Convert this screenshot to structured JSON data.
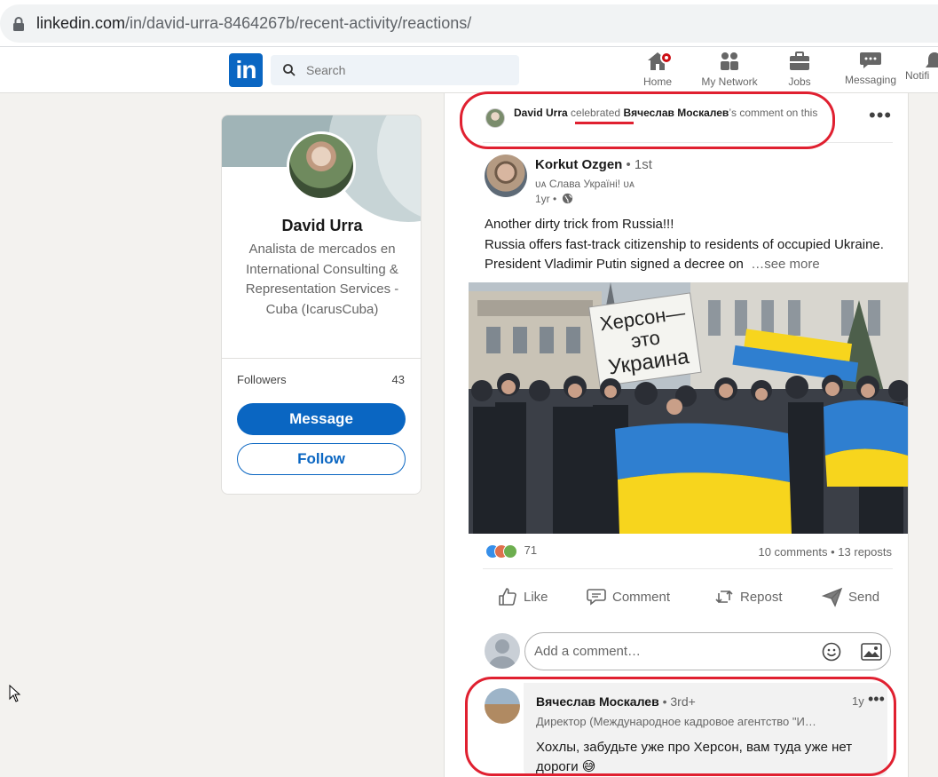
{
  "browser": {
    "url_host": "linkedin.com",
    "url_path": "/in/david-urra-8464267b/recent-activity/reactions/"
  },
  "nav": {
    "logo_text": "in",
    "search_placeholder": "Search",
    "items": [
      {
        "label": "Home",
        "icon": "home-icon"
      },
      {
        "label": "My Network",
        "icon": "network-icon"
      },
      {
        "label": "Jobs",
        "icon": "briefcase-icon"
      },
      {
        "label": "Messaging",
        "icon": "messaging-icon"
      },
      {
        "label": "Notifi",
        "icon": "bell-icon"
      }
    ]
  },
  "profile": {
    "name": "David Urra",
    "headline": "Analista de mercados en International Consulting & Representation Services - Cuba (IcarusCuba)",
    "followers_label": "Followers",
    "followers_count": "43",
    "message_label": "Message",
    "follow_label": "Follow"
  },
  "activity": {
    "actor": "David Urra",
    "verb": "celebrated",
    "target": "Вячеслав Москалев",
    "suffix": "’s comment on this"
  },
  "post": {
    "author_name": "Korkut Ozgen",
    "author_degree": " • 1st",
    "author_tagline": "ᴜᴀ Слава Україні! ᴜᴀ",
    "time": "1yr •",
    "text_line1": "Another dirty trick from Russia!!!",
    "text_line2": "Russia offers fast-track citizenship to residents of occupied Ukraine. President Vladimir Putin signed a decree on",
    "see_more": "…see more",
    "image_sign": "Херсон—это Украина",
    "reaction_count": "71",
    "comments_reposts": "10 comments • 13 reposts",
    "actions": {
      "like": "Like",
      "comment": "Comment",
      "repost": "Repost",
      "send": "Send"
    },
    "comment_placeholder": "Add a comment…"
  },
  "comment": {
    "author": "Вячеслав Москалев",
    "degree": " • 3rd+",
    "time": "1y",
    "headline": "Директор (Международное кадровое агентство \"И…",
    "text": "Хохлы, забудьте уже про Херсон, вам туда уже нет дороги 😅"
  },
  "colors": {
    "linkedin_blue": "#0a66c2",
    "annotation_red": "#e02030",
    "notification_red": "#cc1016"
  }
}
